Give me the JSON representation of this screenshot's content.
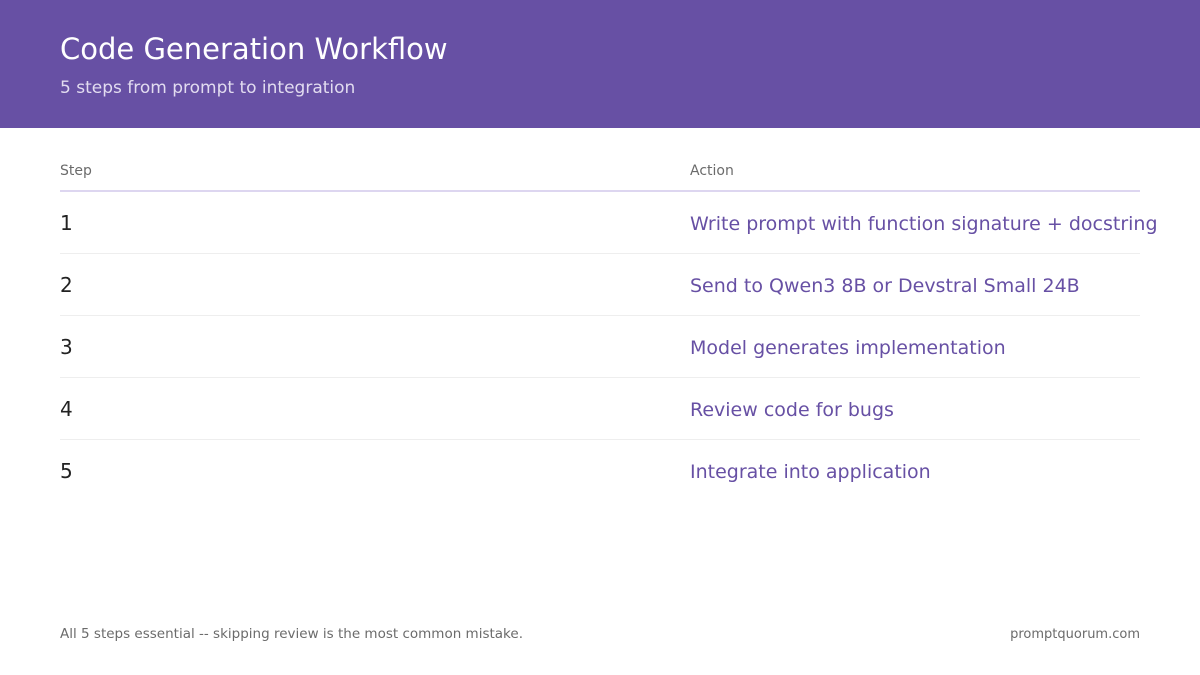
{
  "header": {
    "title": "Code Generation Workflow",
    "subtitle": "5 steps from prompt to integration"
  },
  "table": {
    "columns": [
      "Step",
      "Action"
    ],
    "rows": [
      {
        "step": "1",
        "action": "Write prompt with function signature + docstring"
      },
      {
        "step": "2",
        "action": "Send to Qwen3 8B or Devstral Small 24B"
      },
      {
        "step": "3",
        "action": "Model generates implementation"
      },
      {
        "step": "4",
        "action": "Review code for bugs"
      },
      {
        "step": "5",
        "action": "Integrate into application"
      }
    ]
  },
  "footer": {
    "note": "All 5 steps essential -- skipping review is the most common mistake.",
    "site": "promptquorum.com"
  },
  "colors": {
    "brand": "#6750a4",
    "header_text": "#ffffff",
    "action_text": "#6750a4"
  }
}
